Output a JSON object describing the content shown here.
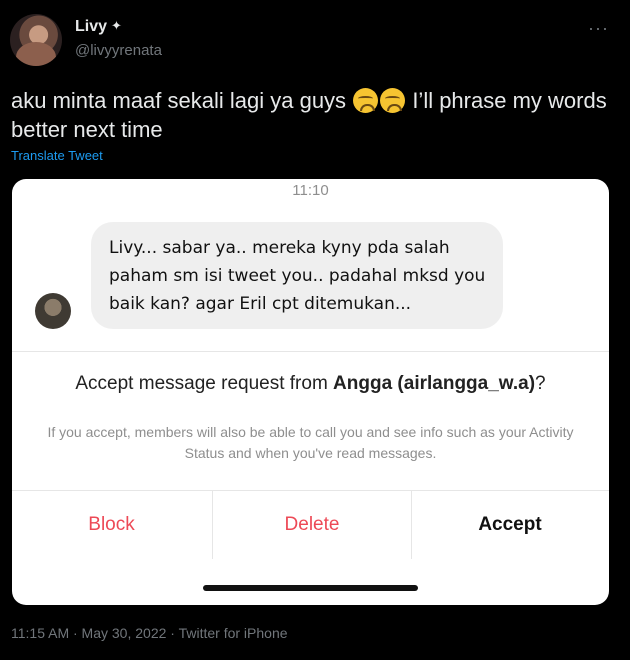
{
  "tweet": {
    "author_name": "Livy",
    "verified_icon": "sparkle-icon",
    "handle": "@livyyrenata",
    "text_before_emoji": "aku minta maaf sekali lagi ya guys",
    "emoji": "disappointed-face-emoji",
    "text_after_emoji": "I’ll phrase my words better next time",
    "translate_label": "Translate Tweet",
    "more_icon": "more-options-icon",
    "meta": "11:15 AM · May 30, 2022 · Twitter for iPhone"
  },
  "screenshot": {
    "time": "11:10",
    "message": "Livy... sabar ya.. mereka kyny pda salah paham sm isi tweet you.. padahal mksd you baik kan? agar Eril cpt ditemukan...",
    "request_prefix": "Accept message request from",
    "request_name": "Angga (airlangga_w.a)",
    "request_suffix": "?",
    "request_note": "If you accept, members will also be able to call you and see info such as your Activity Status and when you've read messages.",
    "actions": {
      "block": "Block",
      "delete": "Delete",
      "accept": "Accept"
    },
    "colors": {
      "destructive": "#ed4956",
      "bubble": "#efefef"
    }
  },
  "colors": {
    "background": "#000000",
    "link": "#1d9bf0",
    "muted": "#71767b"
  }
}
